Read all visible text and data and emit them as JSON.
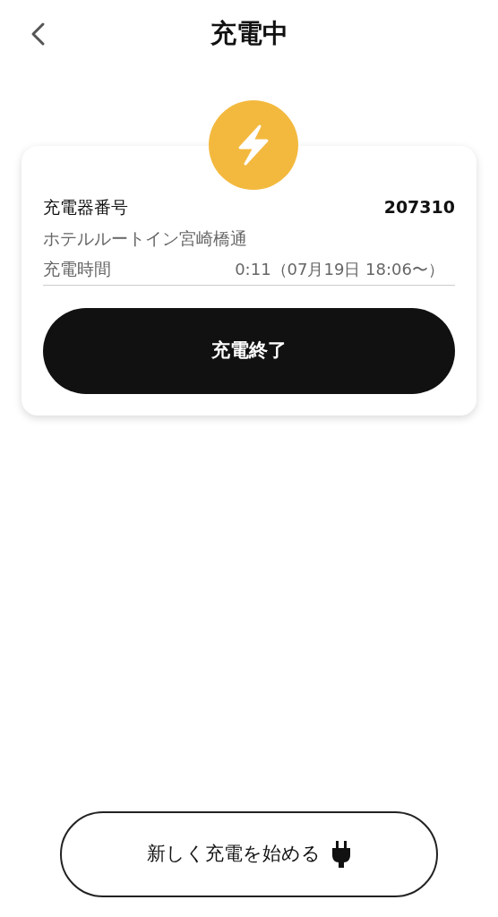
{
  "header": {
    "title": "充電中"
  },
  "card": {
    "charger_label": "充電器番号",
    "charger_number": "207310",
    "location": "ホテルルートイン宮崎橋通",
    "time_label": "充電時間",
    "time_value": "0:11（07月19日 18:06〜）",
    "stop_button": "充電終了"
  },
  "new_charge_button": "新しく充電を始める"
}
